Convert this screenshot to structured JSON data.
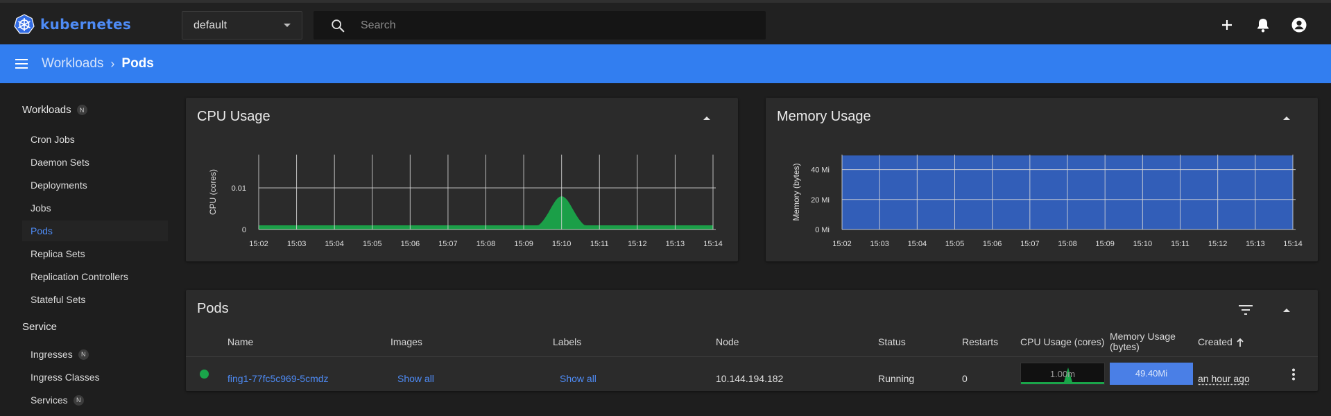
{
  "app": {
    "brand": "kubernetes"
  },
  "header": {
    "namespace": "default",
    "search_placeholder": "Search"
  },
  "breadcrumb": {
    "parent": "Workloads",
    "separator": "›",
    "current": "Pods"
  },
  "sidebar": {
    "sections": [
      {
        "label": "Workloads",
        "badge": "N"
      },
      {
        "label": "Service"
      }
    ],
    "items": [
      {
        "label": "Cron Jobs"
      },
      {
        "label": "Daemon Sets"
      },
      {
        "label": "Deployments"
      },
      {
        "label": "Jobs"
      },
      {
        "label": "Pods",
        "active": true
      },
      {
        "label": "Replica Sets"
      },
      {
        "label": "Replication Controllers"
      },
      {
        "label": "Stateful Sets"
      },
      {
        "label": "Ingresses",
        "badge": "N"
      },
      {
        "label": "Ingress Classes"
      },
      {
        "label": "Services",
        "badge": "N"
      }
    ]
  },
  "cpu_card": {
    "title": "CPU Usage"
  },
  "memory_card": {
    "title": "Memory Usage"
  },
  "chart_data": [
    {
      "type": "area",
      "ylabel": "CPU (cores)",
      "x": [
        "15:02",
        "15:03",
        "15:04",
        "15:05",
        "15:06",
        "15:07",
        "15:08",
        "15:09",
        "15:10",
        "15:11",
        "15:12",
        "15:13",
        "15:14"
      ],
      "y_ticks": [
        "0",
        "0.01"
      ],
      "ylim": [
        0,
        0.018
      ],
      "series": [
        {
          "values": [
            0.001,
            0.001,
            0.001,
            0.001,
            0.001,
            0.001,
            0.001,
            0.001,
            0.008,
            0.001,
            0.001,
            0.001,
            0.001
          ]
        }
      ],
      "color": "#1aa54a"
    },
    {
      "type": "area",
      "ylabel": "Memory (bytes)",
      "x": [
        "15:02",
        "15:03",
        "15:04",
        "15:05",
        "15:06",
        "15:07",
        "15:08",
        "15:09",
        "15:10",
        "15:11",
        "15:12",
        "15:13",
        "15:14"
      ],
      "y_ticks": [
        "0 Mi",
        "20 Mi",
        "40 Mi"
      ],
      "ylim": [
        0,
        50
      ],
      "series": [
        {
          "values": [
            49.4,
            49.4,
            49.4,
            49.4,
            49.4,
            49.4,
            49.4,
            49.4,
            49.4,
            49.4,
            49.4,
            49.4,
            49.4
          ]
        }
      ],
      "color": "#3364c8"
    }
  ],
  "pods_card": {
    "title": "Pods",
    "columns": {
      "name": "Name",
      "images": "Images",
      "labels": "Labels",
      "node": "Node",
      "status": "Status",
      "restarts": "Restarts",
      "cpu": "CPU Usage (cores)",
      "memory_line1": "Memory Usage",
      "memory_line2": "(bytes)",
      "created": "Created"
    },
    "rows": [
      {
        "name": "fing1-77fc5c969-5cmdz",
        "images": "Show all",
        "labels": "Show all",
        "node": "10.144.194.182",
        "status": "Running",
        "restarts": "0",
        "cpu": "1.00m",
        "memory": "49.40Mi",
        "created": "an hour ago",
        "status_color": "#1db954"
      }
    ]
  }
}
